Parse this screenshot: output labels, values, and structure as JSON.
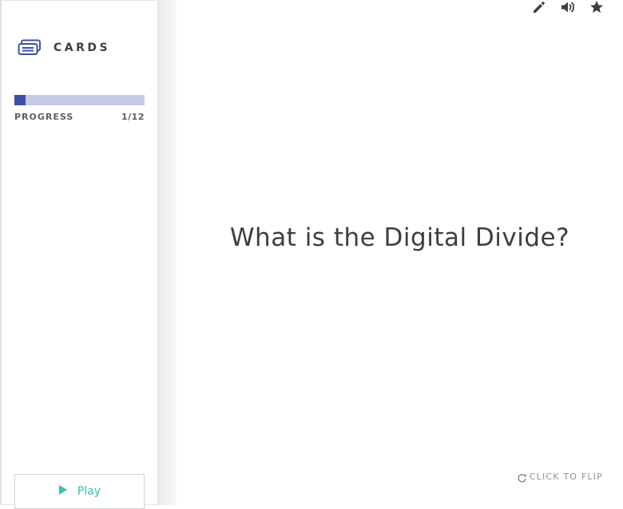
{
  "sidebar": {
    "brand_label": "CARDS",
    "brand_icon": "cards-icon",
    "progress": {
      "label": "PROGRESS",
      "count_text": "1/12",
      "current": 1,
      "total": 12,
      "track_color": "#c5cbe6",
      "fill_color": "#3e4fa6"
    },
    "play_button": {
      "label": "Play",
      "icon": "play-icon",
      "accent_color": "#38c0b0"
    }
  },
  "toolbar": {
    "items": [
      {
        "name": "edit",
        "icon": "pencil-icon"
      },
      {
        "name": "audio",
        "icon": "speaker-icon"
      },
      {
        "name": "favorite",
        "icon": "star-icon"
      }
    ]
  },
  "card": {
    "question": "What is the Digital Divide?",
    "flip_label": "CLICK TO FLIP",
    "flip_icon": "refresh-icon"
  }
}
